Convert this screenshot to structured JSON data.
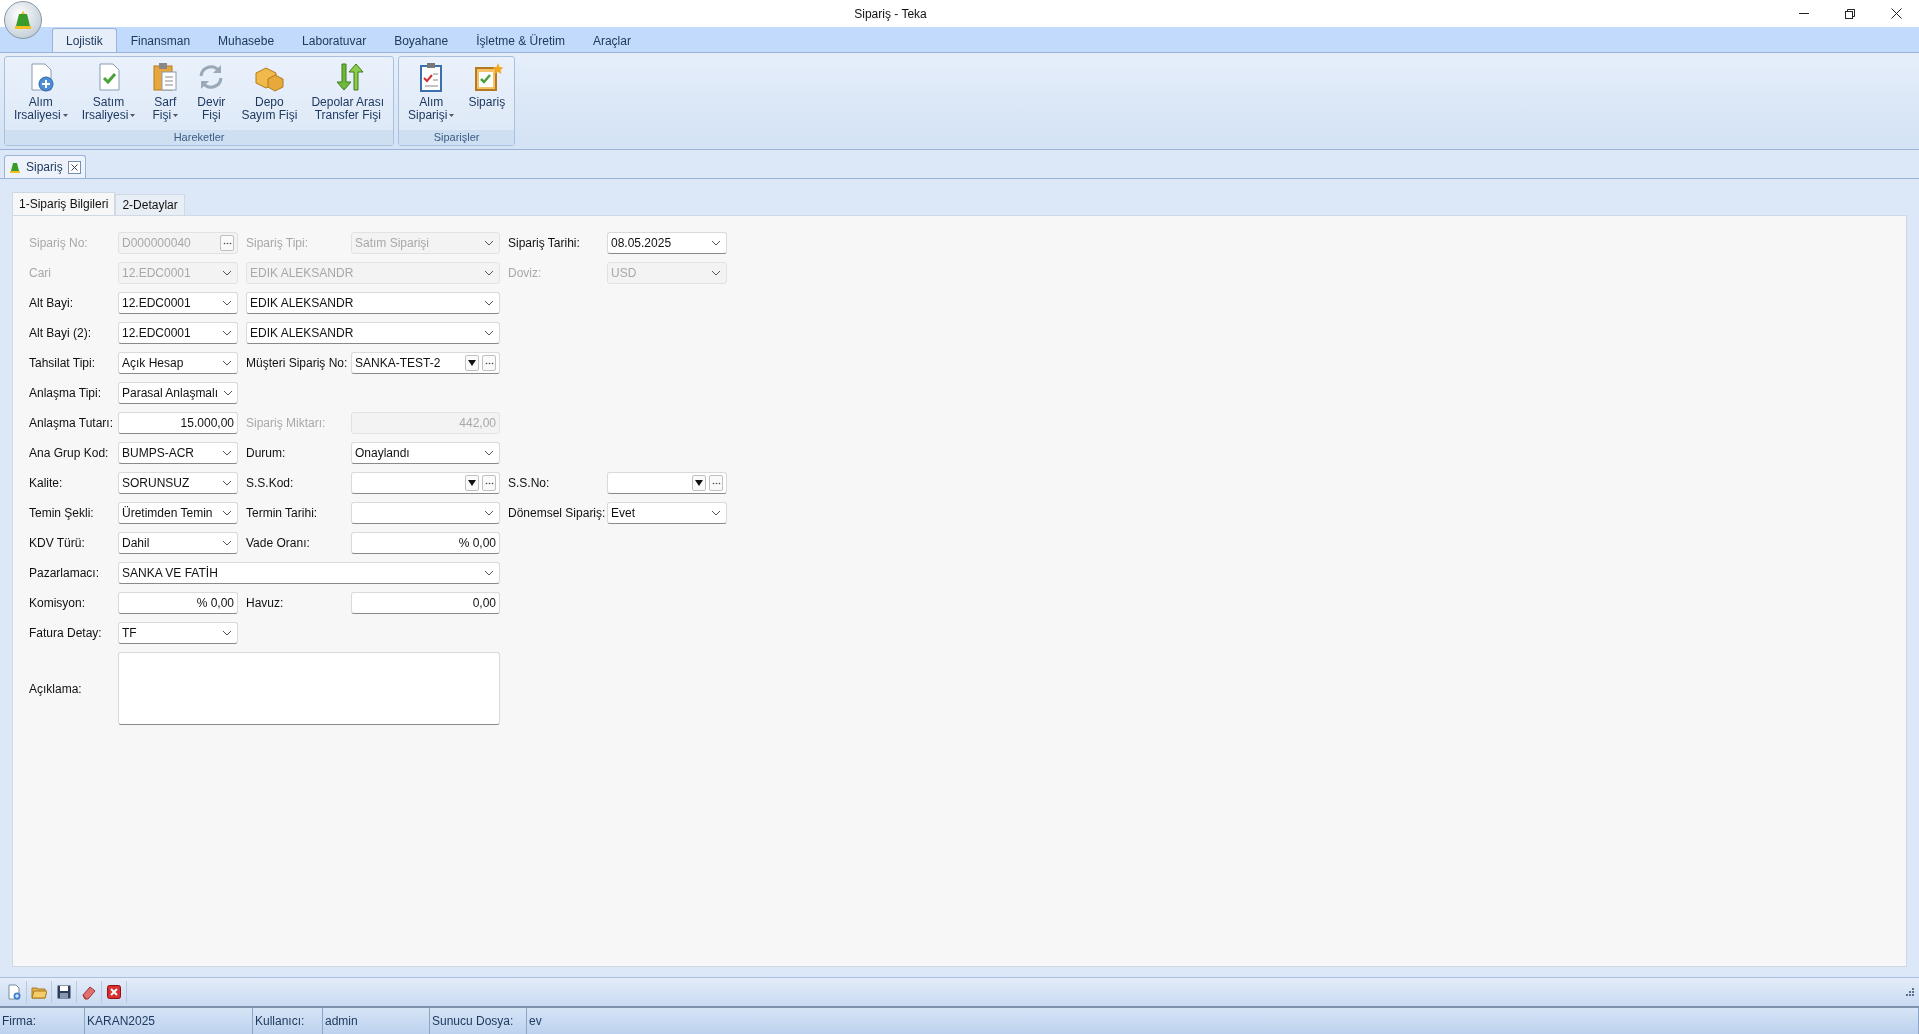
{
  "window": {
    "title": "Sipariş - Teka"
  },
  "ribbon": {
    "tabs": [
      {
        "label": "Lojistik",
        "selected": true
      },
      {
        "label": "Finansman",
        "selected": false
      },
      {
        "label": "Muhasebe",
        "selected": false
      },
      {
        "label": "Laboratuvar",
        "selected": false
      },
      {
        "label": "Boyahane",
        "selected": false
      },
      {
        "label": "İşletme & Üretim",
        "selected": false
      },
      {
        "label": "Araçlar",
        "selected": false
      }
    ],
    "groups": [
      {
        "title": "Hareketler",
        "buttons": [
          {
            "label": "Alım\nIrsaliyesi",
            "kind": "new-document",
            "has_menu": true
          },
          {
            "label": "Satım\nIrsaliyesi",
            "kind": "checked-document",
            "has_menu": true
          },
          {
            "label": "Sarf\nFişi",
            "kind": "clipboard",
            "has_menu": true
          },
          {
            "label": "Devir\nFişi",
            "kind": "refresh",
            "has_menu": false
          },
          {
            "label": "Depo\nSayım Fişi",
            "kind": "boxes",
            "has_menu": false
          },
          {
            "label": "Depolar Arası\nTransfer Fişi",
            "kind": "transfer",
            "has_menu": false
          }
        ]
      },
      {
        "title": "Siparişler",
        "buttons": [
          {
            "label": "Alım\nSiparişi",
            "kind": "checklist",
            "has_menu": true
          },
          {
            "label": "Sipariş",
            "kind": "new-checklist",
            "has_menu": false
          }
        ]
      }
    ]
  },
  "document_tabs": [
    {
      "label": "Sipariş",
      "selected": true
    }
  ],
  "form": {
    "tabs": [
      {
        "label": "1-Sipariş Bilgileri",
        "selected": true
      },
      {
        "label": "2-Detaylar",
        "selected": false
      }
    ],
    "rows": [
      {
        "items": [
          {
            "kind": "label",
            "text": "Sipariş No:",
            "disabled": true
          },
          {
            "kind": "button-edit",
            "value": "D000000040",
            "disabled": true
          },
          {
            "kind": "label",
            "text": "Sipariş Tipi:",
            "disabled": true
          },
          {
            "kind": "combo",
            "value": "Satım Siparişi",
            "disabled": true
          },
          {
            "kind": "label",
            "text": "Sipariş Tarihi:",
            "disabled": false
          },
          {
            "kind": "combo",
            "value": "08.05.2025",
            "disabled": false
          }
        ]
      },
      {
        "items": [
          {
            "kind": "label",
            "text": "Cari",
            "disabled": true
          },
          {
            "kind": "combo",
            "value": "12.EDC0001",
            "disabled": true
          },
          {
            "kind": "combo",
            "value": "EDIK ALEKSANDR",
            "disabled": true
          },
          {
            "kind": "label",
            "text": "Doviz:",
            "disabled": true
          },
          {
            "kind": "combo",
            "value": "USD",
            "disabled": true
          }
        ]
      },
      {
        "items": [
          {
            "kind": "label",
            "text": "Alt Bayi:",
            "disabled": false
          },
          {
            "kind": "combo",
            "value": "12.EDC0001",
            "disabled": false
          },
          {
            "kind": "combo",
            "value": "EDIK ALEKSANDR",
            "disabled": false
          }
        ]
      },
      {
        "items": [
          {
            "kind": "label",
            "text": "Alt Bayi (2):",
            "disabled": false
          },
          {
            "kind": "combo",
            "value": "12.EDC0001",
            "disabled": false
          },
          {
            "kind": "combo",
            "value": "EDIK ALEKSANDR",
            "disabled": false
          }
        ]
      },
      {
        "items": [
          {
            "kind": "label",
            "text": "Tahsilat Tipi:",
            "disabled": false
          },
          {
            "kind": "combo",
            "value": "Açık Hesap",
            "disabled": false
          },
          {
            "kind": "label",
            "text": "Müşteri Sipariş No:",
            "disabled": false
          },
          {
            "kind": "lookup",
            "value": "SANKA-TEST-2",
            "disabled": false
          }
        ]
      },
      {
        "items": [
          {
            "kind": "label",
            "text": "Anlaşma Tipi:",
            "disabled": false
          },
          {
            "kind": "combo",
            "value": "Parasal Anlaşmalı",
            "disabled": false
          }
        ]
      },
      {
        "items": [
          {
            "kind": "label",
            "text": "Anlaşma Tutarı:",
            "disabled": false
          },
          {
            "kind": "number",
            "value": "15.000,00",
            "disabled": false
          },
          {
            "kind": "label",
            "text": "Sipariş Miktarı:",
            "disabled": true
          },
          {
            "kind": "number",
            "value": "442,00",
            "disabled": true
          }
        ]
      },
      {
        "items": [
          {
            "kind": "label",
            "text": "Ana Grup Kod:",
            "disabled": false
          },
          {
            "kind": "combo",
            "value": "BUMPS-ACR",
            "disabled": false
          },
          {
            "kind": "label",
            "text": "Durum:",
            "disabled": false
          },
          {
            "kind": "combo",
            "value": "Onaylandı",
            "disabled": false
          }
        ]
      },
      {
        "items": [
          {
            "kind": "label",
            "text": "Kalite:",
            "disabled": false
          },
          {
            "kind": "combo",
            "value": "SORUNSUZ",
            "disabled": false
          },
          {
            "kind": "label",
            "text": "S.S.Kod:",
            "disabled": false
          },
          {
            "kind": "lookup",
            "disabled": false
          },
          {
            "kind": "label",
            "text": "S.S.No:",
            "disabled": false
          },
          {
            "kind": "lookup",
            "disabled": false
          }
        ]
      },
      {
        "items": [
          {
            "kind": "label",
            "text": "Temin Şekli:",
            "disabled": false
          },
          {
            "kind": "combo",
            "value": "Üretimden Temin",
            "disabled": false
          },
          {
            "kind": "label",
            "text": "Termin Tarihi:",
            "disabled": false
          },
          {
            "kind": "combo",
            "disabled": false
          },
          {
            "kind": "label",
            "text": "Dönemsel Sipariş:",
            "disabled": false
          },
          {
            "kind": "combo",
            "value": "Evet",
            "disabled": false
          }
        ]
      },
      {
        "items": [
          {
            "kind": "label",
            "text": "KDV Türü:",
            "disabled": false
          },
          {
            "kind": "combo",
            "value": "Dahil",
            "disabled": false
          },
          {
            "kind": "label",
            "text": "Vade Oranı:",
            "disabled": false
          },
          {
            "kind": "number",
            "value": "% 0,00",
            "disabled": false
          }
        ]
      },
      {
        "items": [
          {
            "kind": "label",
            "text": "Pazarlamacı:",
            "disabled": false
          },
          {
            "kind": "wide-combo",
            "value": "SANKA VE FATİH",
            "disabled": false
          }
        ]
      },
      {
        "items": [
          {
            "kind": "label",
            "text": "Komisyon:",
            "disabled": false
          },
          {
            "kind": "number",
            "value": "% 0,00",
            "disabled": false
          },
          {
            "kind": "label",
            "text": "Havuz:",
            "disabled": false
          },
          {
            "kind": "number",
            "value": "0,00",
            "disabled": false
          }
        ]
      },
      {
        "items": [
          {
            "kind": "label",
            "text": "Fatura Detay:",
            "disabled": false
          },
          {
            "kind": "combo",
            "value": "TF",
            "disabled": false
          }
        ]
      },
      {
        "items": [
          {
            "kind": "label",
            "text": "Açıklama:",
            "disabled": false
          },
          {
            "kind": "memo",
            "disabled": false
          }
        ]
      }
    ]
  },
  "toolbar": {
    "buttons": [
      {
        "kind": "new"
      },
      {
        "kind": "open"
      },
      {
        "kind": "save"
      },
      {
        "kind": "erase"
      },
      {
        "kind": "delete"
      }
    ]
  },
  "status_bar": {
    "cells": [
      {
        "text": "Firma:"
      },
      {
        "text": "KARAN2025"
      },
      {
        "text": "Kullanıcı:"
      },
      {
        "text": "admin"
      },
      {
        "text": "Sunucu Dosya:"
      },
      {
        "text": "ev"
      }
    ]
  }
}
